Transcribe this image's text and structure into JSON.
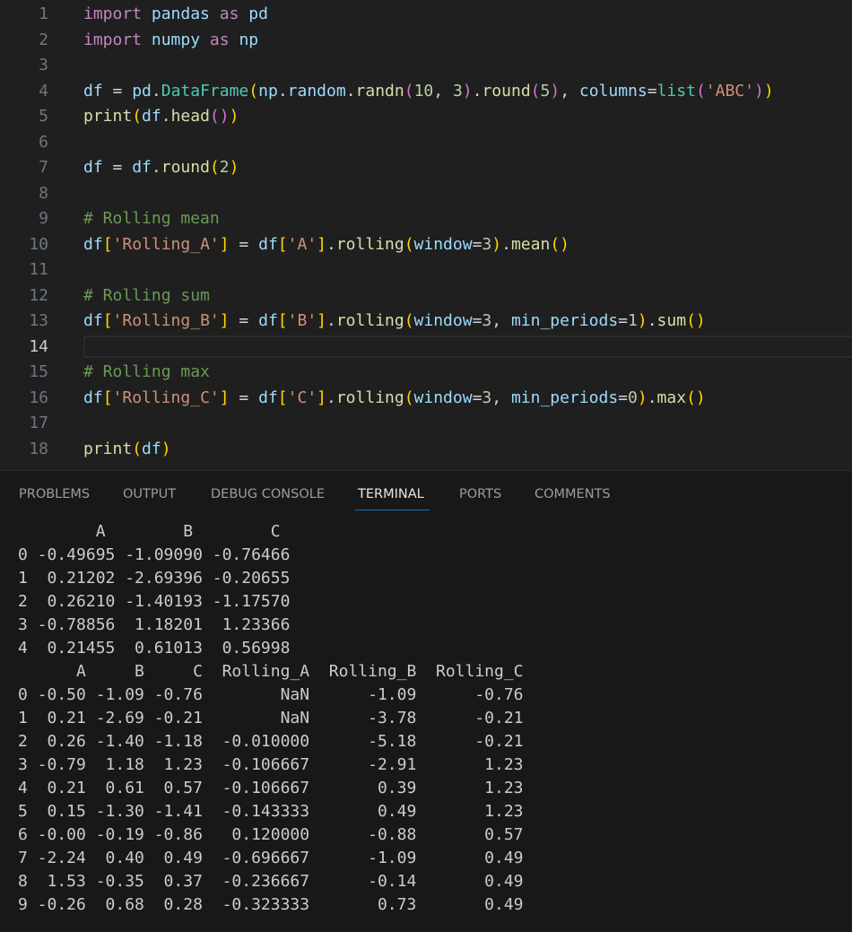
{
  "editor": {
    "lines": [
      {
        "n": "1",
        "tokens": [
          [
            "kw",
            "import"
          ],
          [
            "op",
            " "
          ],
          [
            "var",
            "pandas"
          ],
          [
            "op",
            " "
          ],
          [
            "kw",
            "as"
          ],
          [
            "op",
            " "
          ],
          [
            "var",
            "pd"
          ]
        ]
      },
      {
        "n": "2",
        "tokens": [
          [
            "kw",
            "import"
          ],
          [
            "op",
            " "
          ],
          [
            "var",
            "numpy"
          ],
          [
            "op",
            " "
          ],
          [
            "kw",
            "as"
          ],
          [
            "op",
            " "
          ],
          [
            "var",
            "np"
          ]
        ]
      },
      {
        "n": "3",
        "tokens": []
      },
      {
        "n": "4",
        "tokens": [
          [
            "var",
            "df"
          ],
          [
            "op",
            " = "
          ],
          [
            "var",
            "pd"
          ],
          [
            "op",
            "."
          ],
          [
            "cls",
            "DataFrame"
          ],
          [
            "b1",
            "("
          ],
          [
            "var",
            "np"
          ],
          [
            "op",
            "."
          ],
          [
            "var",
            "random"
          ],
          [
            "op",
            "."
          ],
          [
            "fn",
            "randn"
          ],
          [
            "b2",
            "("
          ],
          [
            "num",
            "10"
          ],
          [
            "op",
            ", "
          ],
          [
            "num",
            "3"
          ],
          [
            "b2",
            ")"
          ],
          [
            "op",
            "."
          ],
          [
            "fn",
            "round"
          ],
          [
            "b2",
            "("
          ],
          [
            "num",
            "5"
          ],
          [
            "b2",
            ")"
          ],
          [
            "op",
            ", "
          ],
          [
            "var",
            "columns"
          ],
          [
            "op",
            "="
          ],
          [
            "cls",
            "list"
          ],
          [
            "b2",
            "("
          ],
          [
            "str",
            "'ABC'"
          ],
          [
            "b2",
            ")"
          ],
          [
            "b1",
            ")"
          ]
        ]
      },
      {
        "n": "5",
        "tokens": [
          [
            "fn",
            "print"
          ],
          [
            "b1",
            "("
          ],
          [
            "var",
            "df"
          ],
          [
            "op",
            "."
          ],
          [
            "fn",
            "head"
          ],
          [
            "b2",
            "()"
          ],
          [
            "b1",
            ")"
          ]
        ]
      },
      {
        "n": "6",
        "tokens": []
      },
      {
        "n": "7",
        "tokens": [
          [
            "var",
            "df"
          ],
          [
            "op",
            " = "
          ],
          [
            "var",
            "df"
          ],
          [
            "op",
            "."
          ],
          [
            "fn",
            "round"
          ],
          [
            "b1",
            "("
          ],
          [
            "num",
            "2"
          ],
          [
            "b1",
            ")"
          ]
        ]
      },
      {
        "n": "8",
        "tokens": []
      },
      {
        "n": "9",
        "tokens": [
          [
            "com",
            "# Rolling mean"
          ]
        ]
      },
      {
        "n": "10",
        "tokens": [
          [
            "var",
            "df"
          ],
          [
            "b1",
            "["
          ],
          [
            "str",
            "'Rolling_A'"
          ],
          [
            "b1",
            "]"
          ],
          [
            "op",
            " = "
          ],
          [
            "var",
            "df"
          ],
          [
            "b1",
            "["
          ],
          [
            "str",
            "'A'"
          ],
          [
            "b1",
            "]"
          ],
          [
            "op",
            "."
          ],
          [
            "fn",
            "rolling"
          ],
          [
            "b1",
            "("
          ],
          [
            "var",
            "window"
          ],
          [
            "op",
            "="
          ],
          [
            "num",
            "3"
          ],
          [
            "b1",
            ")"
          ],
          [
            "op",
            "."
          ],
          [
            "fn",
            "mean"
          ],
          [
            "b1",
            "()"
          ]
        ]
      },
      {
        "n": "11",
        "tokens": []
      },
      {
        "n": "12",
        "tokens": [
          [
            "com",
            "# Rolling sum"
          ]
        ]
      },
      {
        "n": "13",
        "tokens": [
          [
            "var",
            "df"
          ],
          [
            "b1",
            "["
          ],
          [
            "str",
            "'Rolling_B'"
          ],
          [
            "b1",
            "]"
          ],
          [
            "op",
            " = "
          ],
          [
            "var",
            "df"
          ],
          [
            "b1",
            "["
          ],
          [
            "str",
            "'B'"
          ],
          [
            "b1",
            "]"
          ],
          [
            "op",
            "."
          ],
          [
            "fn",
            "rolling"
          ],
          [
            "b1",
            "("
          ],
          [
            "var",
            "window"
          ],
          [
            "op",
            "="
          ],
          [
            "num",
            "3"
          ],
          [
            "op",
            ", "
          ],
          [
            "var",
            "min_periods"
          ],
          [
            "op",
            "="
          ],
          [
            "num",
            "1"
          ],
          [
            "b1",
            ")"
          ],
          [
            "op",
            "."
          ],
          [
            "fn",
            "sum"
          ],
          [
            "b1",
            "()"
          ]
        ]
      },
      {
        "n": "14",
        "tokens": [],
        "current": true
      },
      {
        "n": "15",
        "tokens": [
          [
            "com",
            "# Rolling max"
          ]
        ]
      },
      {
        "n": "16",
        "tokens": [
          [
            "var",
            "df"
          ],
          [
            "b1",
            "["
          ],
          [
            "str",
            "'Rolling_C'"
          ],
          [
            "b1",
            "]"
          ],
          [
            "op",
            " = "
          ],
          [
            "var",
            "df"
          ],
          [
            "b1",
            "["
          ],
          [
            "str",
            "'C'"
          ],
          [
            "b1",
            "]"
          ],
          [
            "op",
            "."
          ],
          [
            "fn",
            "rolling"
          ],
          [
            "b1",
            "("
          ],
          [
            "var",
            "window"
          ],
          [
            "op",
            "="
          ],
          [
            "num",
            "3"
          ],
          [
            "op",
            ", "
          ],
          [
            "var",
            "min_periods"
          ],
          [
            "op",
            "="
          ],
          [
            "num",
            "0"
          ],
          [
            "b1",
            ")"
          ],
          [
            "op",
            "."
          ],
          [
            "fn",
            "max"
          ],
          [
            "b1",
            "()"
          ]
        ]
      },
      {
        "n": "17",
        "tokens": []
      },
      {
        "n": "18",
        "tokens": [
          [
            "fn",
            "print"
          ],
          [
            "b1",
            "("
          ],
          [
            "var",
            "df"
          ],
          [
            "b1",
            ")"
          ]
        ]
      }
    ]
  },
  "panel": {
    "tabs": [
      "PROBLEMS",
      "OUTPUT",
      "DEBUG CONSOLE",
      "TERMINAL",
      "PORTS",
      "COMMENTS"
    ],
    "active_tab": "TERMINAL"
  },
  "terminal": {
    "lines": [
      "        A        B        C",
      "0 -0.49695 -1.09090 -0.76466",
      "1  0.21202 -2.69396 -0.20655",
      "2  0.26210 -1.40193 -1.17570",
      "3 -0.78856  1.18201  1.23366",
      "4  0.21455  0.61013  0.56998",
      "      A     B     C  Rolling_A  Rolling_B  Rolling_C",
      "0 -0.50 -1.09 -0.76        NaN      -1.09      -0.76",
      "1  0.21 -2.69 -0.21        NaN      -3.78      -0.21",
      "2  0.26 -1.40 -1.18  -0.010000      -5.18      -0.21",
      "3 -0.79  1.18  1.23  -0.106667      -2.91       1.23",
      "4  0.21  0.61  0.57  -0.106667       0.39       1.23",
      "5  0.15 -1.30 -1.41  -0.143333       0.49       1.23",
      "6 -0.00 -0.19 -0.86   0.120000      -0.88       0.57",
      "7 -2.24  0.40  0.49  -0.696667      -1.09       0.49",
      "8  1.53 -0.35  0.37  -0.236667      -0.14       0.49",
      "9 -0.26  0.68  0.28  -0.323333       0.73       0.49"
    ]
  },
  "colors": {
    "editor_bg": "#1f1f1f",
    "panel_bg": "#181818",
    "accent": "#0078d4",
    "keyword": "#c586c0",
    "variable": "#9cdcfe",
    "function": "#dcdcaa",
    "class": "#4ec9b0",
    "number": "#b5cea8",
    "string": "#ce9178",
    "comment": "#6a9955"
  }
}
